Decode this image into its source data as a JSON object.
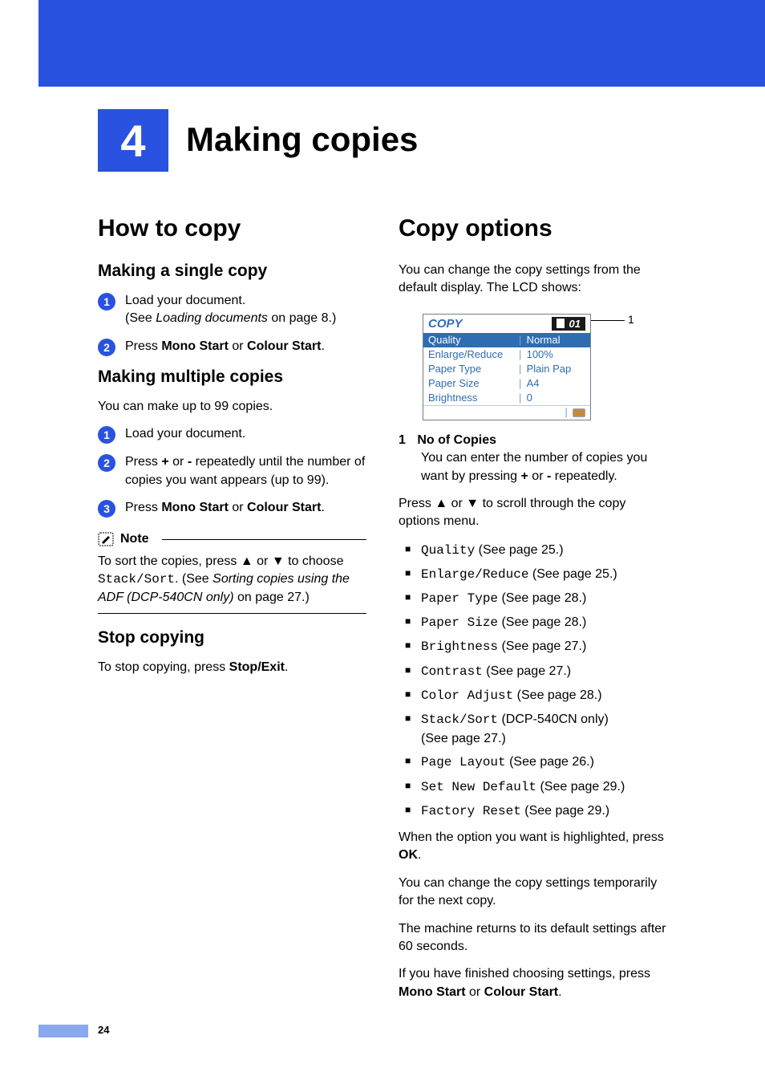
{
  "chapter_number": "4",
  "chapter_title": "Making copies",
  "page_number": "24",
  "left": {
    "section_title": "How to copy",
    "s1_title": "Making a single copy",
    "s1_step1": "Load your document.",
    "s1_step1b_pre": "(See ",
    "s1_step1b_italic": "Loading documents",
    "s1_step1b_post": " on page 8.)",
    "s1_step2_pre": "Press ",
    "s1_step2_bold1": "Mono Start",
    "s1_step2_mid": " or ",
    "s1_step2_bold2": "Colour Start",
    "s1_step2_post": ".",
    "s2_title": "Making multiple copies",
    "s2_intro": "You can make up to 99 copies.",
    "s2_step1": "Load your document.",
    "s2_step2_pre": "Press ",
    "s2_step2_bold1": "+",
    "s2_step2_mid1": " or ",
    "s2_step2_bold2": "-",
    "s2_step2_post": " repeatedly until the number of copies you want appears (up to 99).",
    "s2_step3_pre": "Press ",
    "s2_step3_bold1": "Mono Start",
    "s2_step3_mid": " or ",
    "s2_step3_bold2": "Colour Start",
    "s2_step3_post": ".",
    "note_label": "Note",
    "note_pre": "To sort the copies, press ▲ or ▼ to choose ",
    "note_mono": "Stack/Sort",
    "note_mid": ". (See ",
    "note_italic": "Sorting copies using the ADF (DCP-540CN only)",
    "note_post": " on page 27.)",
    "s3_title": "Stop copying",
    "s3_text_pre": "To stop copying, press ",
    "s3_text_bold": "Stop/Exit",
    "s3_text_post": "."
  },
  "right": {
    "section_title": "Copy options",
    "intro": "You can change the copy settings from the default display. The LCD shows:",
    "lcd": {
      "title": "COPY",
      "copies": "01",
      "rows": [
        {
          "label": "Quality",
          "value": "Normal",
          "sel": true
        },
        {
          "label": "Enlarge/Reduce",
          "value": "100%"
        },
        {
          "label": "Paper Type",
          "value": "Plain Pap"
        },
        {
          "label": "Paper Size",
          "value": "A4"
        },
        {
          "label": "Brightness",
          "value": "0"
        }
      ]
    },
    "callout_num": "1",
    "def_num": "1",
    "def_title": "No of Copies",
    "def_body_pre": "You can enter the number of copies you want by pressing ",
    "def_body_bold1": "+",
    "def_body_mid": " or ",
    "def_body_bold2": "-",
    "def_body_post": " repeatedly.",
    "scroll_text": "Press ▲ or ▼ to scroll through the copy options menu.",
    "options": [
      {
        "mono": "Quality",
        "post": " (See page 25.)"
      },
      {
        "mono": "Enlarge/Reduce",
        "post": " (See page 25.)"
      },
      {
        "mono": "Paper Type",
        "post": " (See page 28.)"
      },
      {
        "mono": "Paper Size",
        "post": " (See page 28.)"
      },
      {
        "mono": "Brightness",
        "post": " (See page 27.)"
      },
      {
        "mono": "Contrast",
        "post": " (See page 27.)"
      },
      {
        "mono": "Color Adjust",
        "post": " (See page 28.)"
      },
      {
        "mono": "Stack/Sort",
        "post": " (DCP-540CN only)",
        "sub": "(See page 27.)"
      },
      {
        "mono": "Page Layout",
        "post": " (See page 26.)"
      },
      {
        "mono": "Set New Default",
        "post": " (See page 29.)"
      },
      {
        "mono": "Factory Reset",
        "post": " (See page 29.)"
      }
    ],
    "after1_pre": "When the option you want is highlighted, press ",
    "after1_bold": "OK",
    "after1_post": ".",
    "after2": "You can change the copy settings temporarily for the next copy.",
    "after3": "The machine returns to its default settings after 60 seconds.",
    "after4_pre": "If you have finished choosing settings, press ",
    "after4_bold1": "Mono Start",
    "after4_mid": " or ",
    "after4_bold2": "Colour Start",
    "after4_post": "."
  }
}
